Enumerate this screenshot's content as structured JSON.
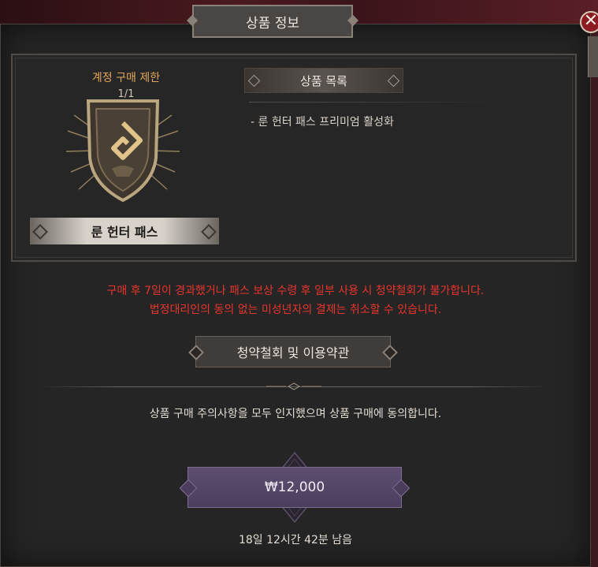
{
  "header": {
    "title": "상품 정보",
    "close_symbol": "✕"
  },
  "product": {
    "limit_label": "계정 구매 제한",
    "limit_count": "1/1",
    "name": "룬 헌터 패스",
    "icon": "rune-hunter-shield-icon"
  },
  "contents": {
    "header": "상품 목록",
    "items": [
      "- 룬 헌터 패스 프리미엄 활성화"
    ]
  },
  "warning_lines": [
    "구매 후 7일이 경과했거나 패스 보상 수령 후 일부 사용 시 청약철회가 불가합니다.",
    "법정대리인의 동의 없는 미성년자의 결제는 취소할 수 있습니다."
  ],
  "terms_button": "청약철회 및 이용약관",
  "consent_text": "상품 구매 주의사항을 모두 인지했으며 상품 구매에 동의합니다.",
  "price": "₩12,000",
  "remaining_time": "18일 12시간 42분 남음",
  "colors": {
    "warning": "#e8342d",
    "limit_label": "#e1a65a",
    "price_button": "#5e4f71"
  }
}
